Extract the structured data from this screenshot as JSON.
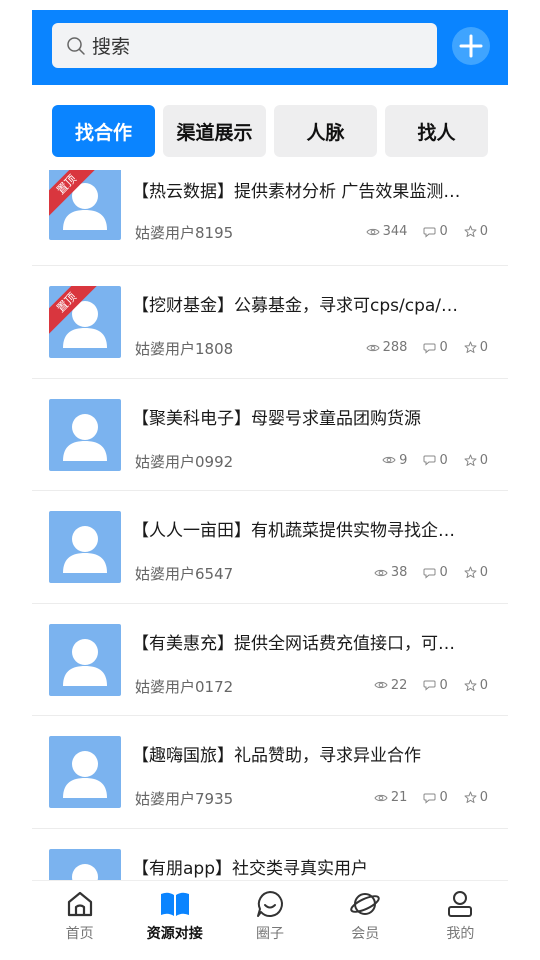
{
  "search": {
    "placeholder": "搜索"
  },
  "tabs": [
    {
      "label": "找合作",
      "active": true
    },
    {
      "label": "渠道展示",
      "active": false
    },
    {
      "label": "人脉",
      "active": false
    },
    {
      "label": "找人",
      "active": false
    }
  ],
  "pinned_label": "置顶",
  "items": [
    {
      "title": "【热云数据】提供素材分析 广告效果监测…",
      "user": "姑婆用户8195",
      "views": "344",
      "comments": "0",
      "stars": "0",
      "pinned": true
    },
    {
      "title": "【挖财基金】公募基金，寻求可cps/cpa/…",
      "user": "姑婆用户1808",
      "views": "288",
      "comments": "0",
      "stars": "0",
      "pinned": true
    },
    {
      "title": "【聚美科电子】母婴号求童品团购货源",
      "user": "姑婆用户0992",
      "views": "9",
      "comments": "0",
      "stars": "0",
      "pinned": false
    },
    {
      "title": "【人人一亩田】有机蔬菜提供实物寻找企…",
      "user": "姑婆用户6547",
      "views": "38",
      "comments": "0",
      "stars": "0",
      "pinned": false
    },
    {
      "title": "【有美惠充】提供全网话费充值接口，可…",
      "user": "姑婆用户0172",
      "views": "22",
      "comments": "0",
      "stars": "0",
      "pinned": false
    },
    {
      "title": "【趣嗨国旅】礼品赞助，寻求异业合作",
      "user": "姑婆用户7935",
      "views": "21",
      "comments": "0",
      "stars": "0",
      "pinned": false
    },
    {
      "title": "【有朋app】社交类寻真实用户",
      "user": "",
      "views": "",
      "comments": "",
      "stars": "",
      "pinned": false
    }
  ],
  "nav": [
    {
      "label": "首页",
      "icon": "home-icon",
      "active": false
    },
    {
      "label": "资源对接",
      "icon": "book-icon",
      "active": true
    },
    {
      "label": "圈子",
      "icon": "smile-icon",
      "active": false
    },
    {
      "label": "会员",
      "icon": "planet-icon",
      "active": false
    },
    {
      "label": "我的",
      "icon": "user-icon",
      "active": false
    }
  ],
  "colors": {
    "primary": "#0a84ff",
    "avatar": "#7bb3ef",
    "pinned": "#d9363e"
  }
}
